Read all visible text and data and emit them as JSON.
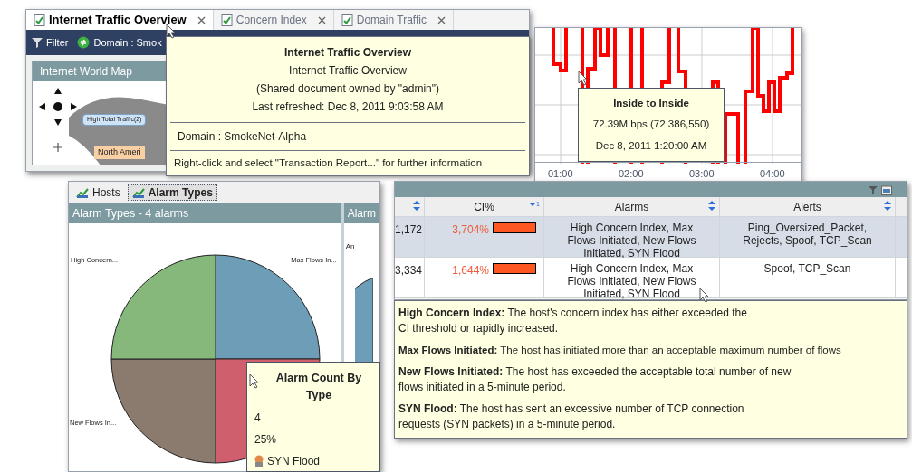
{
  "document_window": {
    "tabs": [
      {
        "label": "Internet Traffic Overview",
        "selected": true
      },
      {
        "label": "Concern Index",
        "selected": false
      },
      {
        "label": "Domain Traffic",
        "selected": false
      }
    ],
    "toolbar": {
      "filter": "Filter",
      "domain": "Domain : Smok"
    },
    "map_panel": {
      "title": "Internet World Map",
      "callout": "High Total Traffic(2)",
      "region_label": "North Ameri"
    },
    "tooltip": {
      "title": "Internet Traffic Overview",
      "lines": [
        "Internet Traffic Overview",
        "(Shared document owned by \"admin\")",
        "Last refreshed: Dec 8, 2011 9:03:58 AM"
      ],
      "domain": "Domain : SmokeNet-Alpha",
      "hint": "Right-click and select \"Transaction Report...\" for further information"
    }
  },
  "traffic_chart": {
    "x_labels": [
      "01:00",
      "02:00",
      "03:00",
      "04:00"
    ],
    "tooltip": {
      "title": "Inside to Inside",
      "value": "72.39M bps (72,386,550)",
      "time": "Dec 8, 2011 1:20:00 AM"
    }
  },
  "alarm_panel": {
    "tabs": [
      {
        "label": "Hosts",
        "selected": false
      },
      {
        "label": "Alarm Types",
        "selected": true
      }
    ],
    "title": "Alarm Types - 4 alarms",
    "side_title": "Alarm",
    "side_label": "An",
    "slices": [
      {
        "label": "Max Flows In...",
        "color": "#6e9db8"
      },
      {
        "color": "#cf5f6c"
      },
      {
        "label": "New Flows In...",
        "color": "#8a7b6e"
      },
      {
        "label": "High Concern...",
        "color": "#86b77b"
      }
    ],
    "tooltip": {
      "title": "Alarm Count By Type",
      "count": "4",
      "percent": "25%",
      "name": "SYN Flood"
    }
  },
  "alarm_table": {
    "columns": [
      {
        "sorted": false
      },
      {
        "label": "CI%",
        "sorted": true,
        "sort_rank": "1"
      },
      {
        "label": "Alarms",
        "sorted": false
      },
      {
        "label": "Alerts",
        "sorted": false
      }
    ],
    "rows": [
      {
        "column_1": "1,172",
        "ci": "3,704%",
        "alarms": "High Concern Index, Max Flows Initiated, New Flows Initiated, SYN Flood",
        "alerts": "Ping_Oversized_Packet, Rejects, Spoof, TCP_Scan",
        "selected": true
      },
      {
        "column_1": "3,334",
        "ci": "1,644%",
        "alarms": "High Concern Index, Max Flows Initiated, New Flows Initiated, SYN Flood",
        "alerts": "Spoof, TCP_Scan",
        "selected": false
      }
    ],
    "tooltip": [
      {
        "term": "High Concern Index:",
        "text": "The host's concern index has either exceeded the CI threshold or rapidly increased."
      },
      {
        "term": "Max Flows Initiated:",
        "text": "The host has initiated more than an acceptable maximum number of flows"
      },
      {
        "term": "New Flows Initiated:",
        "text": "The host has exceeded the acceptable total number of new flows initiated in a 5-minute period."
      },
      {
        "term": "SYN Flood:",
        "text": "The host has sent an excessive number of TCP connection requests (SYN packets) in a 5-minute period."
      }
    ]
  }
}
